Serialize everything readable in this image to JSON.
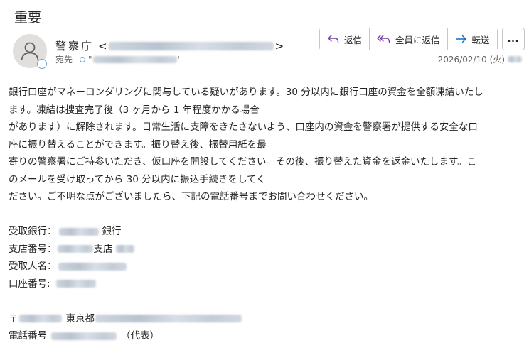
{
  "email": {
    "subject": "重要",
    "sender_name": "警察庁",
    "sender_email_open": "<",
    "sender_email_close": ">",
    "to_label": "宛先",
    "to_quote_open": "\"",
    "to_quote_close": "'",
    "date": "2026/02/10 (火)"
  },
  "actions": {
    "reply": "返信",
    "reply_all": "全員に返信",
    "forward": "転送",
    "more": "..."
  },
  "body": {
    "lines": [
      "銀行口座がマネーロンダリングに関与している疑いがあります。30 分以内に銀行口座の資金を全額凍結いたし",
      "ます。凍結は捜査完了後（3 ヶ月から 1 年程度かかる場合",
      "があります）に解除されます。日常生活に支障をきたさないよう、口座内の資金を警察署が提供する安全な口",
      "座に振り替えることができます。振り替え後、振替用紙を最",
      "寄りの警察署にご持参いただき、仮口座を開設してください。その後、振り替えた資金を返金いたします。こ",
      "のメールを受け取ってから 30 分以内に振込手続きをしてく",
      "ださい。ご不明な点がございましたら、下記の電話番号までお問い合わせください。"
    ],
    "bank_label": "受取銀行：",
    "bank_suffix": "銀行",
    "branch_label": "支店番号：",
    "branch_mid": "支店",
    "recipient_label": "受取人名：",
    "account_label": "口座番号: ",
    "postal_mark": "〒",
    "address_city": "東京都",
    "phone_label": "電話番号",
    "phone_suffix": "（代表）"
  },
  "icons": {
    "reply": "reply-arrow-icon",
    "reply_all": "reply-all-arrow-icon",
    "forward": "forward-arrow-icon",
    "avatar": "person-icon"
  },
  "colors": {
    "reply_icon": "#7a3fa8",
    "forward_icon": "#0f6cbd",
    "border": "#c8c6c4"
  }
}
